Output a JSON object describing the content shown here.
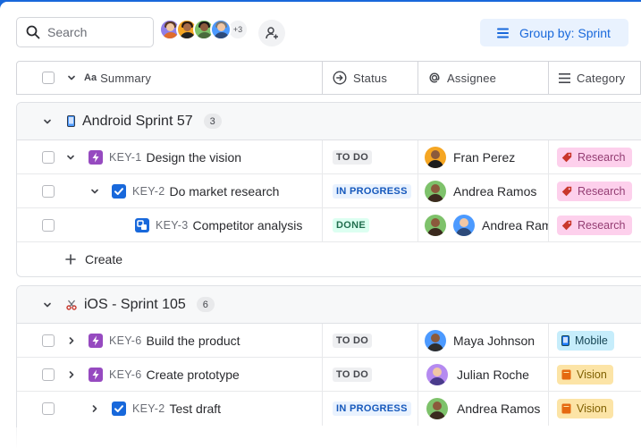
{
  "toolbar": {
    "search_placeholder": "Search",
    "more_avatars": "+3",
    "group_by_label": "Group by: Sprint"
  },
  "columns": {
    "summary": "Summary",
    "status": "Status",
    "assignee": "Assignee",
    "category": "Category"
  },
  "groups": [
    {
      "name": "Android Sprint 57",
      "count": "3",
      "icon": "mobile-phone-icon",
      "rows": [
        {
          "key": "KEY-1",
          "title": "Design the vision",
          "status": "TO DO",
          "assignees": [
            "Fran Perez"
          ],
          "category": "Research",
          "type": "epic"
        },
        {
          "key": "KEY-2",
          "title": "Do market research",
          "status": "IN PROGRESS",
          "assignees": [
            "Andrea Ramos"
          ],
          "category": "Research",
          "type": "task"
        },
        {
          "key": "KEY-3",
          "title": "Competitor analysis",
          "status": "DONE",
          "assignees": [
            "Andrea Ram"
          ],
          "category": "Research",
          "type": "subtask"
        }
      ],
      "create_label": "Create"
    },
    {
      "name": "iOS - Sprint 105",
      "count": "6",
      "icon": "scissors-icon",
      "rows": [
        {
          "key": "KEY-6",
          "title": "Build the product",
          "status": "TO DO",
          "assignees": [
            "Maya Johnson"
          ],
          "category": "Mobile",
          "type": "epic"
        },
        {
          "key": "KEY-6",
          "title": "Create prototype",
          "status": "TO DO",
          "assignees": [
            "Julian Roche"
          ],
          "category": "Vision",
          "type": "epic"
        },
        {
          "key": "KEY-2",
          "title": "Test draft",
          "status": "IN PROGRESS",
          "assignees": [
            "Andrea Ramos"
          ],
          "category": "Vision",
          "type": "task"
        }
      ]
    }
  ],
  "colors": {
    "brand": "#1868db",
    "epic": "#964ac0",
    "task": "#1868db"
  }
}
